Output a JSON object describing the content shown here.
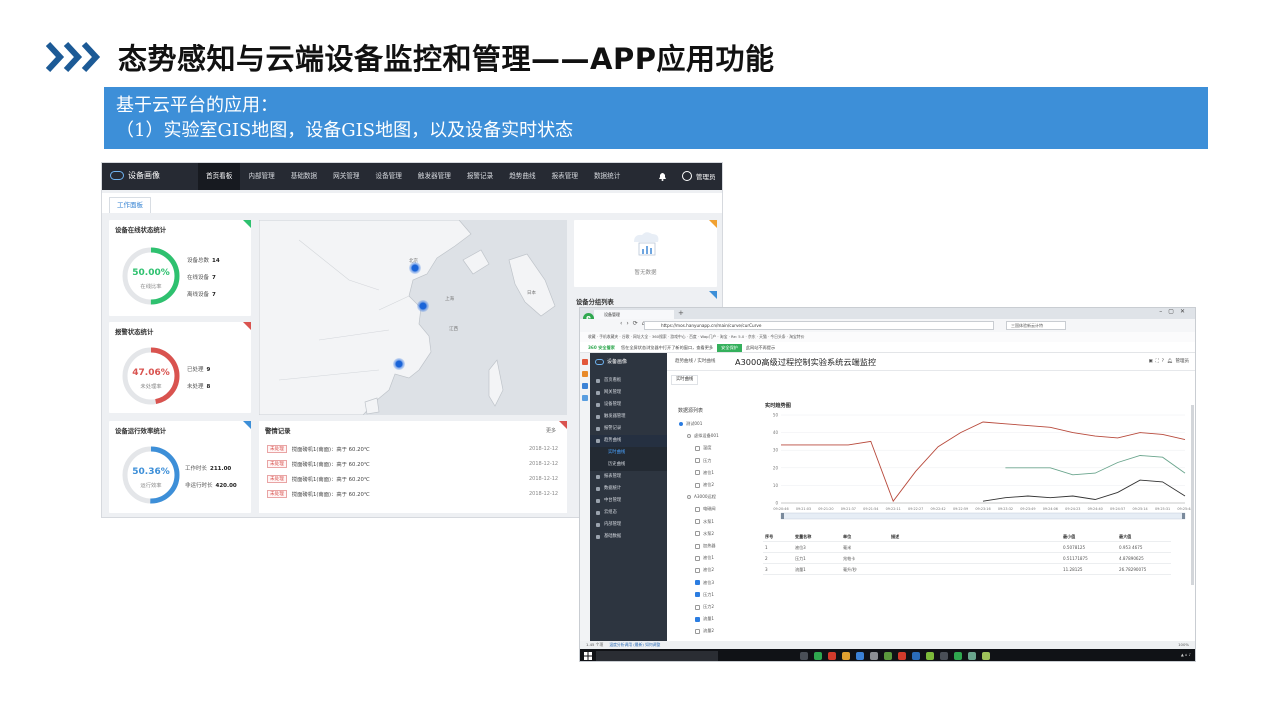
{
  "slide": {
    "title": "态势感知与云端设备监控和管理——APP应用功能",
    "banner_line1": "基于云平台的应用：",
    "banner_line2": "（1）实验室GIS地图，设备GIS地图，以及设备实时状态"
  },
  "dashboard": {
    "brand": "设备画像",
    "nav": [
      "首页看板",
      "内部管理",
      "基础数据",
      "网关管理",
      "设备管理",
      "触发器管理",
      "报警记录",
      "趋势曲线",
      "报表管理",
      "数据统计"
    ],
    "user": "管理员",
    "tab": "工作面板",
    "online": {
      "title": "设备在线状态统计",
      "pct": "50.00%",
      "sub": "在线比率",
      "total_label": "设备总数",
      "total": "14",
      "on_label": "在线设备",
      "on": "7",
      "off_label": "离线设备",
      "off": "7",
      "value": 0.5,
      "color": "#2ec16f"
    },
    "alarm_stat": {
      "title": "报警状态统计",
      "pct": "47.06%",
      "sub": "未处理率",
      "done_label": "已处理",
      "done": "9",
      "undone_label": "未处理",
      "undone": "8",
      "value": 0.4706,
      "color": "#d9534f"
    },
    "efficiency": {
      "title": "设备运行效率统计",
      "pct": "50.36%",
      "sub": "运行效率",
      "work_label": "工作时长",
      "work": "211.00",
      "idle_label": "非运行时长",
      "idle": "420.00",
      "value": 0.5036,
      "color": "#3d8fd8"
    },
    "map_labels": [
      "北京",
      "上海",
      "江西",
      "日本"
    ],
    "no_data": "暂无数据",
    "device_list_title": "设备分组列表",
    "alarm_log": {
      "title": "警情记录",
      "more": "更多",
      "rows": [
        {
          "tag": "未处理",
          "text": "搅面磅机1(南面)：高于 60.20℃",
          "date": "2018-12-12"
        },
        {
          "tag": "未处理",
          "text": "搅面磅机1(南面)：高于 60.20℃",
          "date": "2018-12-12"
        },
        {
          "tag": "未处理",
          "text": "搅面磅机1(南面)：高于 60.20℃",
          "date": "2018-12-12"
        },
        {
          "tag": "未处理",
          "text": "搅面磅机1(南面)：高于 60.20℃",
          "date": "2018-12-12"
        }
      ]
    }
  },
  "browser": {
    "tab_title": "设备管理",
    "url": "https://mos.hanyunapp.cn/main/curve/curCurve",
    "ext_field": "三国体验新云计特",
    "bookmarks": "收藏  ·  手机收藏夹  ·  谷歌  ·  网址大全  ·  360搜索  ·  游戏中心  ·  百度  ·  Wap门户  ·  淘宝  ·  Re: 5.0  ·  京东  ·  天猫  ·  今日头条  ·  淘宝特价",
    "notice_prefix": "360 安全管家",
    "notice_text": "您在全屏状态浏览器中打开了新的窗口，查看更多",
    "notice_btn": "安全保护",
    "notice_tail": "此网站不再提示",
    "status_left": "1.45 个项",
    "status_mid": "温度分析调用 (最新) 如何调整",
    "status_right": "100%"
  },
  "app": {
    "brand": "设备画像",
    "menu": [
      {
        "label": "首页看板",
        "type": "item"
      },
      {
        "label": "网关管理",
        "type": "item"
      },
      {
        "label": "设备管理",
        "type": "item"
      },
      {
        "label": "触发器管理",
        "type": "item"
      },
      {
        "label": "报警记录",
        "type": "item"
      },
      {
        "label": "趋势曲线",
        "type": "open"
      },
      {
        "label": "实时曲线",
        "type": "sub-on"
      },
      {
        "label": "历史曲线",
        "type": "sub"
      },
      {
        "label": "报表管理",
        "type": "item"
      },
      {
        "label": "数据统计",
        "type": "item"
      },
      {
        "label": "中台管理",
        "type": "item"
      },
      {
        "label": "云组态",
        "type": "item"
      },
      {
        "label": "内部管理",
        "type": "item"
      },
      {
        "label": "基础数据",
        "type": "item"
      }
    ],
    "breadcrumb": "趋势曲线 / 实时曲线",
    "title": "A3000高级过程控制实验系统云端监控",
    "header_user": "管理员",
    "subtab": "实时曲线",
    "tree_title": "数据源列表",
    "tree": [
      {
        "label": "测试001",
        "checked": true,
        "level": 0
      },
      {
        "label": "虚拟设备001",
        "checked": false,
        "level": 1
      },
      {
        "label": "温度",
        "checked": false,
        "level": 2
      },
      {
        "label": "压力",
        "checked": false,
        "level": 2
      },
      {
        "label": "液位1",
        "checked": false,
        "level": 2
      },
      {
        "label": "液位2",
        "checked": false,
        "level": 2
      },
      {
        "label": "A3000远程",
        "checked": false,
        "level": 1
      },
      {
        "label": "电磁阀",
        "checked": false,
        "level": 2
      },
      {
        "label": "水泵1",
        "checked": false,
        "level": 2
      },
      {
        "label": "水泵2",
        "checked": false,
        "level": 2
      },
      {
        "label": "加热器",
        "checked": false,
        "level": 2
      },
      {
        "label": "液位1",
        "checked": false,
        "level": 2
      },
      {
        "label": "液位2",
        "checked": false,
        "level": 2
      },
      {
        "label": "液位3",
        "checked": true,
        "level": 2
      },
      {
        "label": "压力1",
        "checked": true,
        "level": 2
      },
      {
        "label": "压力2",
        "checked": false,
        "level": 2
      },
      {
        "label": "流量1",
        "checked": true,
        "level": 2
      },
      {
        "label": "流量2",
        "checked": false,
        "level": 2
      }
    ],
    "table": {
      "headers": [
        "序号",
        "变量名称",
        "单位",
        "描述",
        "最小值",
        "最大值"
      ],
      "rows": [
        [
          "1",
          "液位3",
          "毫米",
          "",
          "0.5078125",
          "0.953 4675"
        ],
        [
          "2",
          "压力1",
          "兆帕卡",
          "",
          "0.51171875",
          "4.87890625"
        ],
        [
          "3",
          "流量1",
          "毫升/秒",
          "",
          "11.28125",
          "26.78290075"
        ]
      ]
    }
  },
  "chart_data": {
    "type": "line",
    "title": "实时趋势图",
    "ylim": [
      0,
      50
    ],
    "yticks": [
      0,
      10,
      20,
      30,
      40,
      50
    ],
    "categories": [
      "09:20:46",
      "09:21:03",
      "09:21:20",
      "09:21:37",
      "09:21:54",
      "09:22:11",
      "09:22:27",
      "09:22:42",
      "09:22:59",
      "09:23:16",
      "09:23:32",
      "09:23:49",
      "09:24:06",
      "09:24:23",
      "09:24:40",
      "09:24:57",
      "09:25:14",
      "09:25:31",
      "09:25:48"
    ],
    "series": [
      {
        "color": "#b84a3c",
        "values": [
          33,
          33,
          33,
          33,
          35,
          1,
          18,
          32,
          40,
          46,
          45,
          44,
          43,
          40,
          38,
          37,
          40,
          39,
          36
        ]
      },
      {
        "color": "#6aa58d",
        "values": [
          null,
          null,
          null,
          null,
          null,
          null,
          null,
          null,
          null,
          null,
          20,
          20,
          20,
          16,
          17,
          23,
          27,
          26,
          17
        ]
      },
      {
        "color": "#333333",
        "values": [
          null,
          null,
          null,
          null,
          null,
          null,
          null,
          null,
          null,
          1,
          3,
          4,
          3,
          4,
          2,
          6,
          13,
          12,
          4
        ]
      }
    ]
  }
}
